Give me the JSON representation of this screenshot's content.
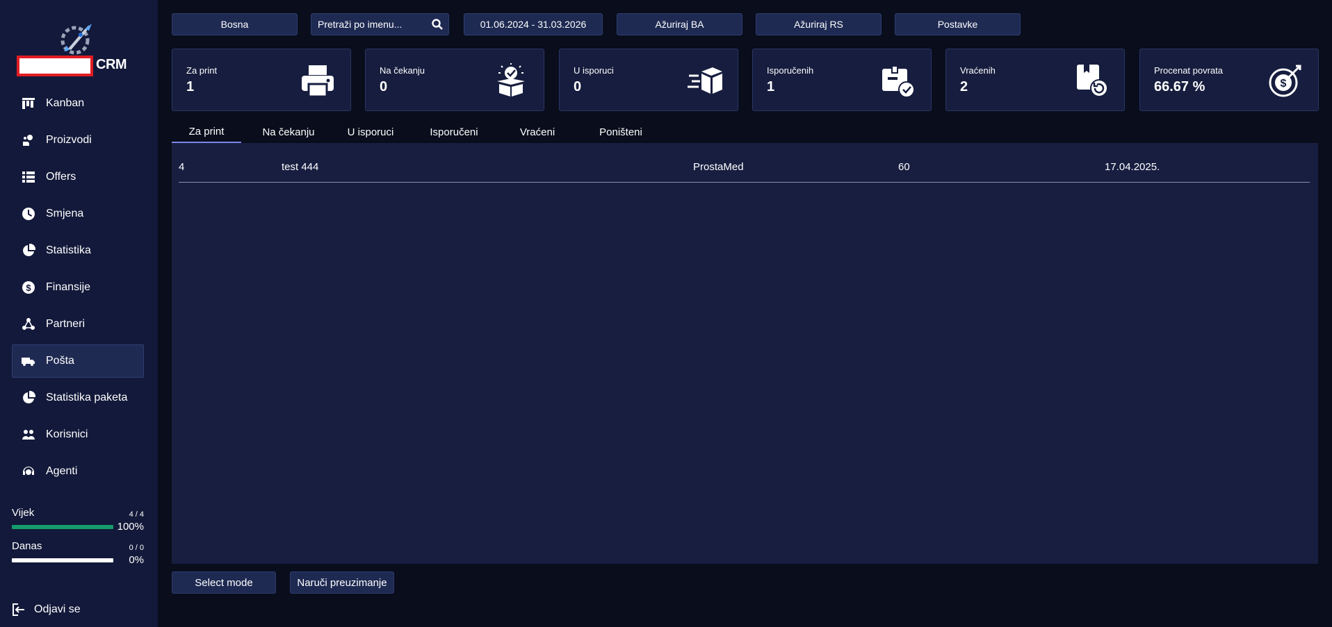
{
  "app": {
    "brand_suffix": "CRM"
  },
  "sidebar": {
    "items": [
      {
        "label": "Kanban",
        "icon": "kanban-icon"
      },
      {
        "label": "Proizvodi",
        "icon": "products-icon"
      },
      {
        "label": "Offers",
        "icon": "list-icon"
      },
      {
        "label": "Smjena",
        "icon": "clock-icon"
      },
      {
        "label": "Statistika",
        "icon": "pie-chart-icon"
      },
      {
        "label": "Finansije",
        "icon": "dollar-icon"
      },
      {
        "label": "Partneri",
        "icon": "share-nodes-icon"
      },
      {
        "label": "Pošta",
        "icon": "truck-icon",
        "active": true
      },
      {
        "label": "Statistika paketa",
        "icon": "pie-chart-icon"
      },
      {
        "label": "Korisnici",
        "icon": "users-icon"
      },
      {
        "label": "Agenti",
        "icon": "headset-icon"
      }
    ],
    "progress": {
      "vijek": {
        "label": "Vijek",
        "count": "4 / 4",
        "percent_text": "100%",
        "fraction": 1.0
      },
      "danas": {
        "label": "Danas",
        "count": "0 / 0",
        "percent_text": "0%",
        "fraction": 0.0
      }
    },
    "logout_label": "Odjavi se"
  },
  "toolbar": {
    "region": "Bosna",
    "search_placeholder": "Pretraži po imenu...",
    "date_range": "01.06.2024 - 31.03.2026",
    "update_ba": "Ažuriraj BA",
    "update_rs": "Ažuriraj RS",
    "settings": "Postavke"
  },
  "stats": [
    {
      "label": "Za print",
      "value": "1",
      "icon": "printer-icon"
    },
    {
      "label": "Na čekanju",
      "value": "0",
      "icon": "box-check-icon"
    },
    {
      "label": "U isporuci",
      "value": "0",
      "icon": "fast-box-icon"
    },
    {
      "label": "Isporučenih",
      "value": "1",
      "icon": "delivered-box-icon"
    },
    {
      "label": "Vraćenih",
      "value": "2",
      "icon": "return-box-icon"
    },
    {
      "label": "Procenat povrata",
      "value": "66.67 %",
      "icon": "money-target-icon"
    }
  ],
  "tabs": [
    {
      "label": "Za print",
      "active": true
    },
    {
      "label": "Na čekanju"
    },
    {
      "label": "U isporuci"
    },
    {
      "label": "Isporučeni"
    },
    {
      "label": "Vraćeni"
    },
    {
      "label": "Poništeni"
    }
  ],
  "table": {
    "rows": [
      [
        "4",
        "test 444",
        "ProstaMed",
        "60",
        "17.04.2025."
      ]
    ]
  },
  "actions": {
    "select_mode": "Select mode",
    "order_pickup": "Naruči preuzimanje"
  },
  "colors": {
    "background": "#090d1c",
    "sidebar": "#13193a",
    "panel": "#171e40",
    "progress_green": "#159c6a",
    "tab_underline": "#7b86e8"
  }
}
